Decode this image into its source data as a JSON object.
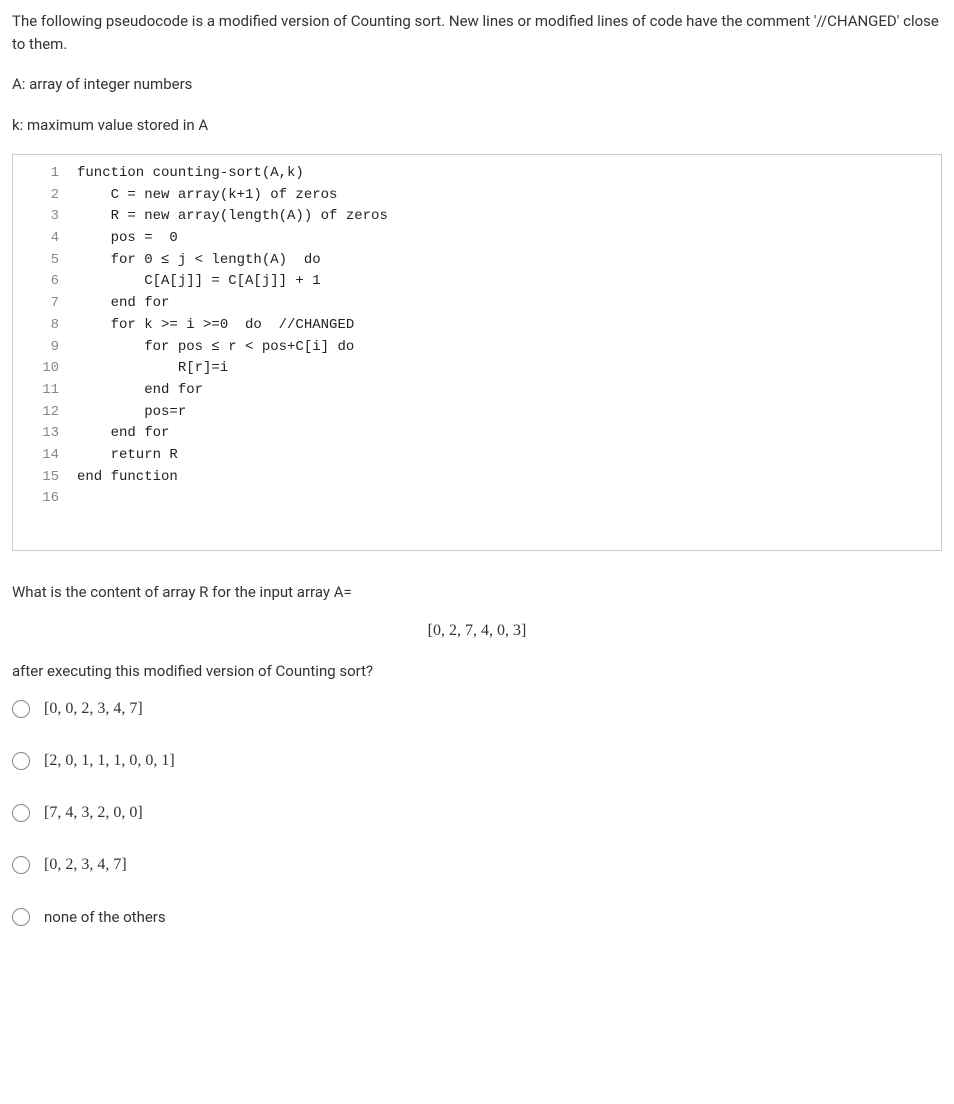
{
  "prompt": {
    "p1": "The following pseudocode is a modified version of Counting sort. New lines or modified lines of code have the comment '//CHANGED' close to them.",
    "p2": "A: array of integer numbers",
    "p3": "k: maximum value stored in A"
  },
  "code": {
    "lines": [
      {
        "n": "1",
        "t": "function counting-sort(A,k)"
      },
      {
        "n": "2",
        "t": "    C = new array(k+1) of zeros"
      },
      {
        "n": "3",
        "t": "    R = new array(length(A)) of zeros"
      },
      {
        "n": "4",
        "t": "    pos =  0"
      },
      {
        "n": "5",
        "t": "    for 0 ≤ j < length(A)  do"
      },
      {
        "n": "6",
        "t": "        C[A[j]] = C[A[j]] + 1"
      },
      {
        "n": "7",
        "t": "    end for"
      },
      {
        "n": "8",
        "t": "    for k >= i >=0  do  //CHANGED"
      },
      {
        "n": "9",
        "t": "        for pos ≤ r < pos+C[i] do"
      },
      {
        "n": "10",
        "t": "            R[r]=i"
      },
      {
        "n": "11",
        "t": "        end for"
      },
      {
        "n": "12",
        "t": "        pos=r"
      },
      {
        "n": "13",
        "t": "    end for"
      },
      {
        "n": "14",
        "t": "    return R"
      },
      {
        "n": "15",
        "t": "end function"
      },
      {
        "n": "16",
        "t": ""
      }
    ]
  },
  "question": {
    "q1": "What is the content of array R for the input array A=",
    "array": "[0, 2, 7, 4, 0, 3]",
    "q2": "after executing this modified version of Counting sort?"
  },
  "options": [
    {
      "label": "[0, 0, 2, 3, 4, 7]",
      "math": true
    },
    {
      "label": "[2, 0, 1, 1, 1, 0, 0, 1]",
      "math": true
    },
    {
      "label": "[7, 4, 3, 2, 0, 0]",
      "math": true
    },
    {
      "label": "[0, 2, 3, 4, 7]",
      "math": true
    },
    {
      "label": "none of the others",
      "math": false
    }
  ]
}
